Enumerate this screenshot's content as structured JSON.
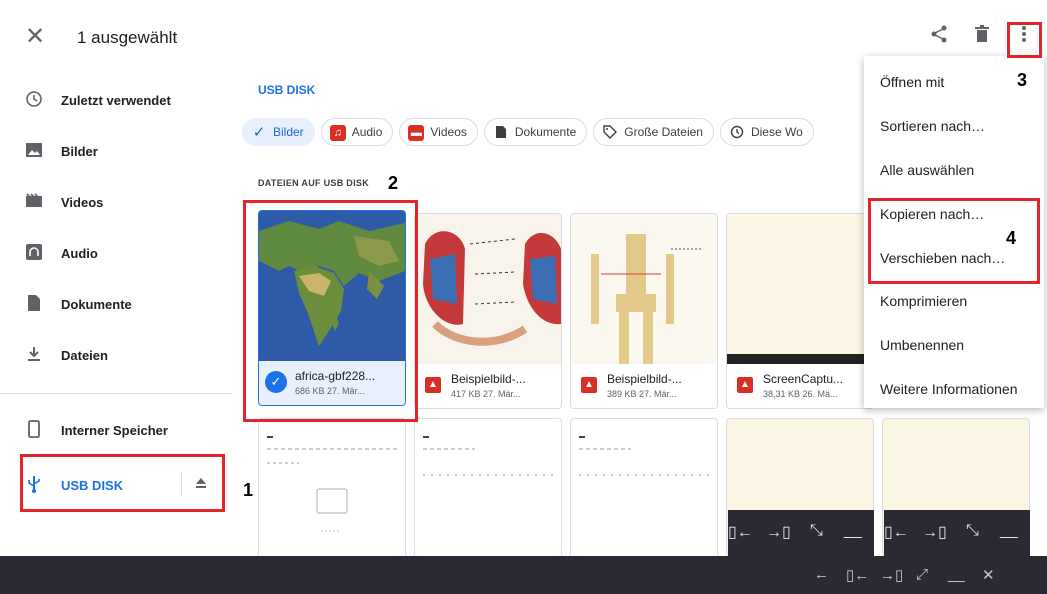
{
  "header": {
    "close_icon": "close-icon",
    "selection_title": "1 ausgewählt",
    "actions": [
      "share-icon",
      "delete-icon",
      "more-vert-icon"
    ]
  },
  "sidebar": {
    "items": [
      {
        "label": "Zuletzt verwendet",
        "icon": "clock-icon"
      },
      {
        "label": "Bilder",
        "icon": "image-icon"
      },
      {
        "label": "Videos",
        "icon": "video-icon"
      },
      {
        "label": "Audio",
        "icon": "audio-icon"
      },
      {
        "label": "Dokumente",
        "icon": "document-icon"
      },
      {
        "label": "Dateien",
        "icon": "download-icon"
      }
    ],
    "storage": [
      {
        "label": "Interner Speicher",
        "icon": "phone-icon"
      },
      {
        "label": "USB DISK",
        "icon": "usb-icon",
        "eject_icon": "eject-icon"
      }
    ]
  },
  "main": {
    "location_title": "USB DISK",
    "chips": [
      {
        "label": "Bilder",
        "active": true
      },
      {
        "label": "Audio"
      },
      {
        "label": "Videos"
      },
      {
        "label": "Dokumente"
      },
      {
        "label": "Große Dateien"
      },
      {
        "label": "Diese Wo"
      }
    ],
    "section_label": "DATEIEN AUF USB DISK",
    "files": [
      {
        "name": "africa-gbf228...",
        "meta": "686 KB 27. Mär...",
        "selected": true
      },
      {
        "name": "Beispielbild-...",
        "meta": "417 KB 27. Mär..."
      },
      {
        "name": "Beispielbild-...",
        "meta": "389 KB 27. Mär..."
      },
      {
        "name": "ScreenCaptu...",
        "meta": "38,31 KB 26. Mä..."
      }
    ]
  },
  "menu": {
    "items": [
      "Öffnen mit",
      "Sortieren nach…",
      "Alle auswählen",
      "Kopieren nach…",
      "Verschieben nach…",
      "Komprimieren",
      "Umbenennen",
      "Weitere Informationen"
    ]
  },
  "annotations": {
    "labels": [
      "1",
      "2",
      "3",
      "4"
    ],
    "color": "#e3242b"
  },
  "colors": {
    "accent": "#1a73e8",
    "selected_bg": "#e8f0fe",
    "dark_bar": "#2b2a33"
  }
}
